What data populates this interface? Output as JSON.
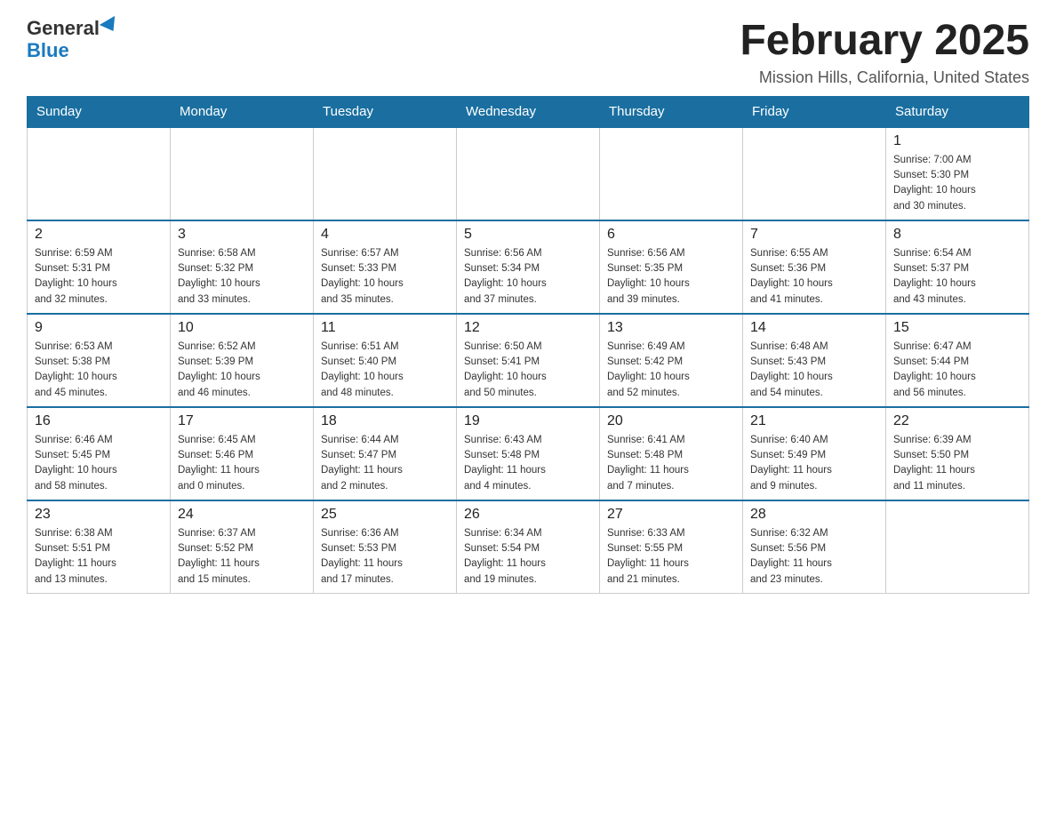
{
  "header": {
    "logo_general": "General",
    "logo_blue": "Blue",
    "title": "February 2025",
    "location": "Mission Hills, California, United States"
  },
  "days_of_week": [
    "Sunday",
    "Monday",
    "Tuesday",
    "Wednesday",
    "Thursday",
    "Friday",
    "Saturday"
  ],
  "weeks": [
    [
      {
        "day": "",
        "info": ""
      },
      {
        "day": "",
        "info": ""
      },
      {
        "day": "",
        "info": ""
      },
      {
        "day": "",
        "info": ""
      },
      {
        "day": "",
        "info": ""
      },
      {
        "day": "",
        "info": ""
      },
      {
        "day": "1",
        "info": "Sunrise: 7:00 AM\nSunset: 5:30 PM\nDaylight: 10 hours\nand 30 minutes."
      }
    ],
    [
      {
        "day": "2",
        "info": "Sunrise: 6:59 AM\nSunset: 5:31 PM\nDaylight: 10 hours\nand 32 minutes."
      },
      {
        "day": "3",
        "info": "Sunrise: 6:58 AM\nSunset: 5:32 PM\nDaylight: 10 hours\nand 33 minutes."
      },
      {
        "day": "4",
        "info": "Sunrise: 6:57 AM\nSunset: 5:33 PM\nDaylight: 10 hours\nand 35 minutes."
      },
      {
        "day": "5",
        "info": "Sunrise: 6:56 AM\nSunset: 5:34 PM\nDaylight: 10 hours\nand 37 minutes."
      },
      {
        "day": "6",
        "info": "Sunrise: 6:56 AM\nSunset: 5:35 PM\nDaylight: 10 hours\nand 39 minutes."
      },
      {
        "day": "7",
        "info": "Sunrise: 6:55 AM\nSunset: 5:36 PM\nDaylight: 10 hours\nand 41 minutes."
      },
      {
        "day": "8",
        "info": "Sunrise: 6:54 AM\nSunset: 5:37 PM\nDaylight: 10 hours\nand 43 minutes."
      }
    ],
    [
      {
        "day": "9",
        "info": "Sunrise: 6:53 AM\nSunset: 5:38 PM\nDaylight: 10 hours\nand 45 minutes."
      },
      {
        "day": "10",
        "info": "Sunrise: 6:52 AM\nSunset: 5:39 PM\nDaylight: 10 hours\nand 46 minutes."
      },
      {
        "day": "11",
        "info": "Sunrise: 6:51 AM\nSunset: 5:40 PM\nDaylight: 10 hours\nand 48 minutes."
      },
      {
        "day": "12",
        "info": "Sunrise: 6:50 AM\nSunset: 5:41 PM\nDaylight: 10 hours\nand 50 minutes."
      },
      {
        "day": "13",
        "info": "Sunrise: 6:49 AM\nSunset: 5:42 PM\nDaylight: 10 hours\nand 52 minutes."
      },
      {
        "day": "14",
        "info": "Sunrise: 6:48 AM\nSunset: 5:43 PM\nDaylight: 10 hours\nand 54 minutes."
      },
      {
        "day": "15",
        "info": "Sunrise: 6:47 AM\nSunset: 5:44 PM\nDaylight: 10 hours\nand 56 minutes."
      }
    ],
    [
      {
        "day": "16",
        "info": "Sunrise: 6:46 AM\nSunset: 5:45 PM\nDaylight: 10 hours\nand 58 minutes."
      },
      {
        "day": "17",
        "info": "Sunrise: 6:45 AM\nSunset: 5:46 PM\nDaylight: 11 hours\nand 0 minutes."
      },
      {
        "day": "18",
        "info": "Sunrise: 6:44 AM\nSunset: 5:47 PM\nDaylight: 11 hours\nand 2 minutes."
      },
      {
        "day": "19",
        "info": "Sunrise: 6:43 AM\nSunset: 5:48 PM\nDaylight: 11 hours\nand 4 minutes."
      },
      {
        "day": "20",
        "info": "Sunrise: 6:41 AM\nSunset: 5:48 PM\nDaylight: 11 hours\nand 7 minutes."
      },
      {
        "day": "21",
        "info": "Sunrise: 6:40 AM\nSunset: 5:49 PM\nDaylight: 11 hours\nand 9 minutes."
      },
      {
        "day": "22",
        "info": "Sunrise: 6:39 AM\nSunset: 5:50 PM\nDaylight: 11 hours\nand 11 minutes."
      }
    ],
    [
      {
        "day": "23",
        "info": "Sunrise: 6:38 AM\nSunset: 5:51 PM\nDaylight: 11 hours\nand 13 minutes."
      },
      {
        "day": "24",
        "info": "Sunrise: 6:37 AM\nSunset: 5:52 PM\nDaylight: 11 hours\nand 15 minutes."
      },
      {
        "day": "25",
        "info": "Sunrise: 6:36 AM\nSunset: 5:53 PM\nDaylight: 11 hours\nand 17 minutes."
      },
      {
        "day": "26",
        "info": "Sunrise: 6:34 AM\nSunset: 5:54 PM\nDaylight: 11 hours\nand 19 minutes."
      },
      {
        "day": "27",
        "info": "Sunrise: 6:33 AM\nSunset: 5:55 PM\nDaylight: 11 hours\nand 21 minutes."
      },
      {
        "day": "28",
        "info": "Sunrise: 6:32 AM\nSunset: 5:56 PM\nDaylight: 11 hours\nand 23 minutes."
      },
      {
        "day": "",
        "info": ""
      }
    ]
  ]
}
